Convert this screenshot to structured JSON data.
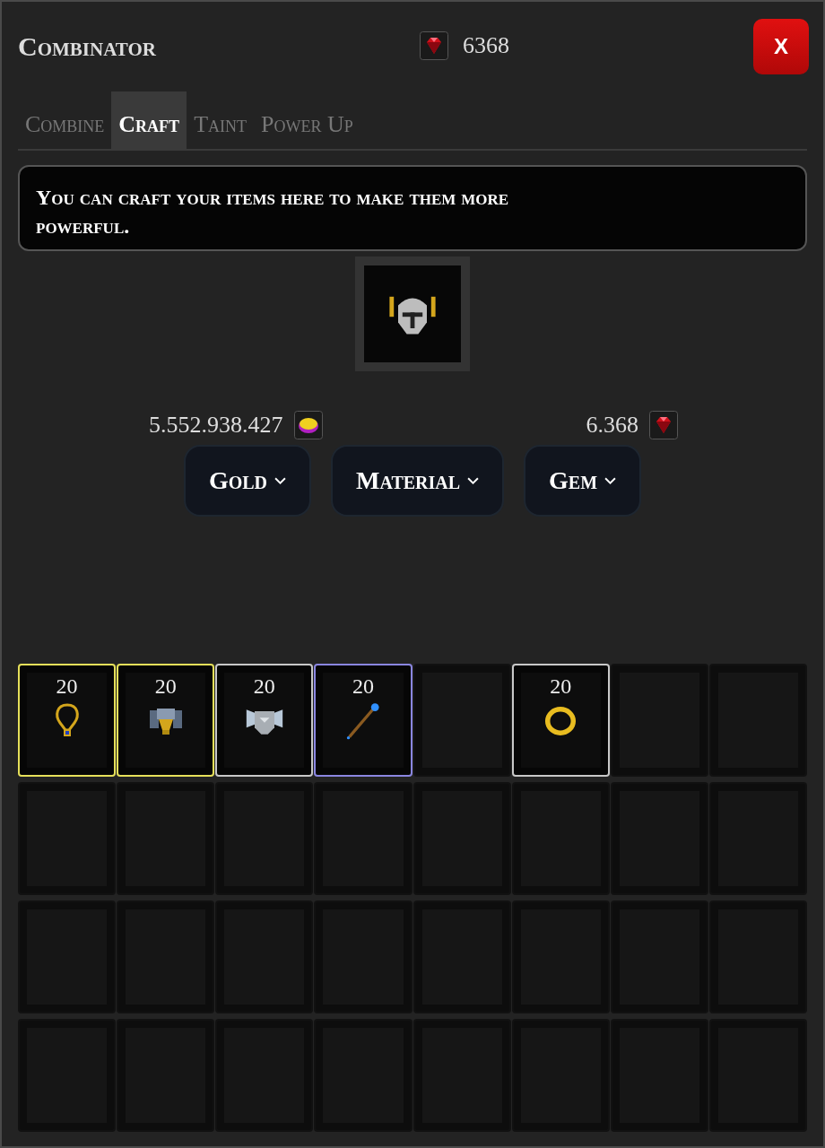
{
  "window": {
    "title": "Combinator",
    "gem_count": "6368",
    "close": "X"
  },
  "tabs": [
    {
      "label": "Combine",
      "selected": false
    },
    {
      "label": "Craft",
      "selected": true
    },
    {
      "label": "Taint",
      "selected": false
    },
    {
      "label": "Power Up",
      "selected": false
    }
  ],
  "info": "You can craft your items here to make them more powerful.",
  "selected_item": {
    "kind": "helmet"
  },
  "balances": {
    "gold": "5.552.938.427",
    "gems": "6.368"
  },
  "buttons": [
    {
      "label": "Gold"
    },
    {
      "label": "Material"
    },
    {
      "label": "Gem"
    }
  ],
  "inventory": [
    {
      "kind": "necklace",
      "count": "20",
      "color": "#e6e05a"
    },
    {
      "kind": "armor",
      "count": "20",
      "color": "#e6e05a"
    },
    {
      "kind": "chest",
      "count": "20",
      "color": "#c8c8c8"
    },
    {
      "kind": "staff",
      "count": "20",
      "color": "#8a86e0"
    },
    {
      "kind": "empty"
    },
    {
      "kind": "ring",
      "count": "20",
      "color": "#c8c8c8"
    },
    {
      "kind": "empty"
    },
    {
      "kind": "empty"
    },
    {
      "kind": "empty"
    },
    {
      "kind": "empty"
    },
    {
      "kind": "empty"
    },
    {
      "kind": "empty"
    },
    {
      "kind": "empty"
    },
    {
      "kind": "empty"
    },
    {
      "kind": "empty"
    },
    {
      "kind": "empty"
    },
    {
      "kind": "empty"
    },
    {
      "kind": "empty"
    },
    {
      "kind": "empty"
    },
    {
      "kind": "empty"
    },
    {
      "kind": "empty"
    },
    {
      "kind": "empty"
    },
    {
      "kind": "empty"
    },
    {
      "kind": "empty"
    },
    {
      "kind": "empty"
    },
    {
      "kind": "empty"
    },
    {
      "kind": "empty"
    },
    {
      "kind": "empty"
    },
    {
      "kind": "empty"
    },
    {
      "kind": "empty"
    },
    {
      "kind": "empty"
    },
    {
      "kind": "empty"
    }
  ]
}
